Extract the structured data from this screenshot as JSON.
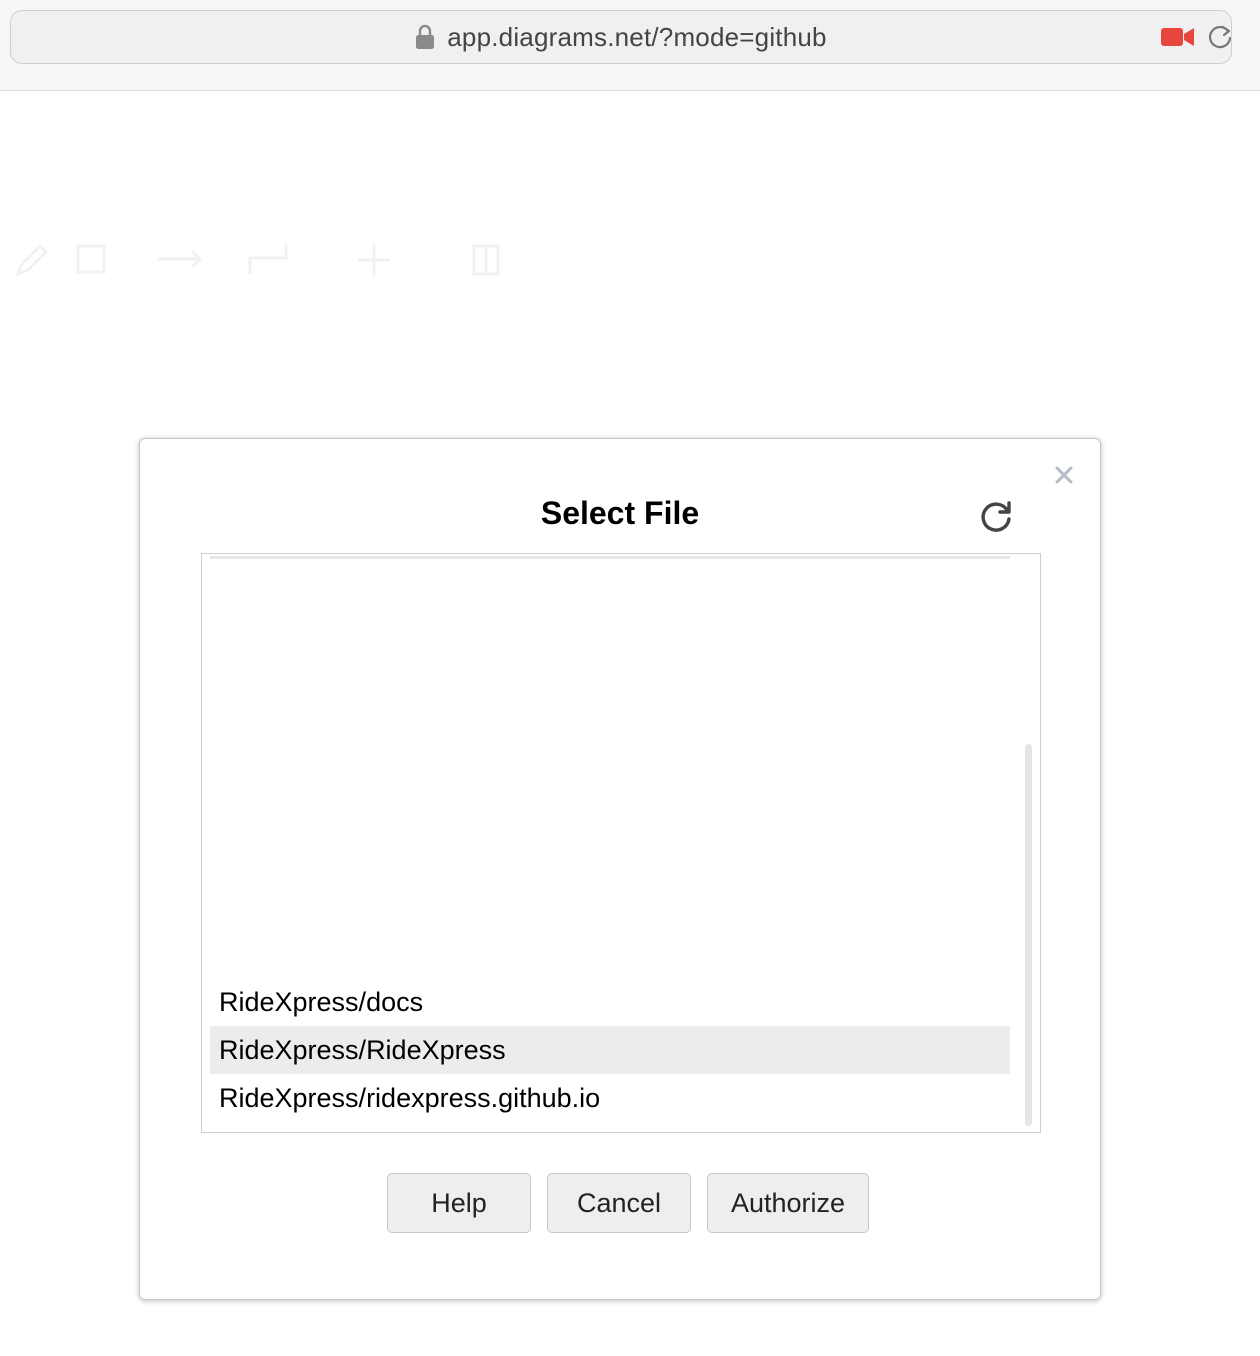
{
  "browser": {
    "url": "app.diagrams.net/?mode=github",
    "record_color": "#e8453c"
  },
  "dialog": {
    "title": "Select File",
    "files": [
      {
        "label": "RideXpress/docs",
        "selected": false
      },
      {
        "label": "RideXpress/RideXpress",
        "selected": true
      },
      {
        "label": "RideXpress/ridexpress.github.io",
        "selected": false
      }
    ],
    "buttons": {
      "help": "Help",
      "cancel": "Cancel",
      "authorize": "Authorize"
    }
  },
  "icons": [
    "lock-icon",
    "camera-icon",
    "reload-icon",
    "close-icon",
    "refresh-icon"
  ]
}
